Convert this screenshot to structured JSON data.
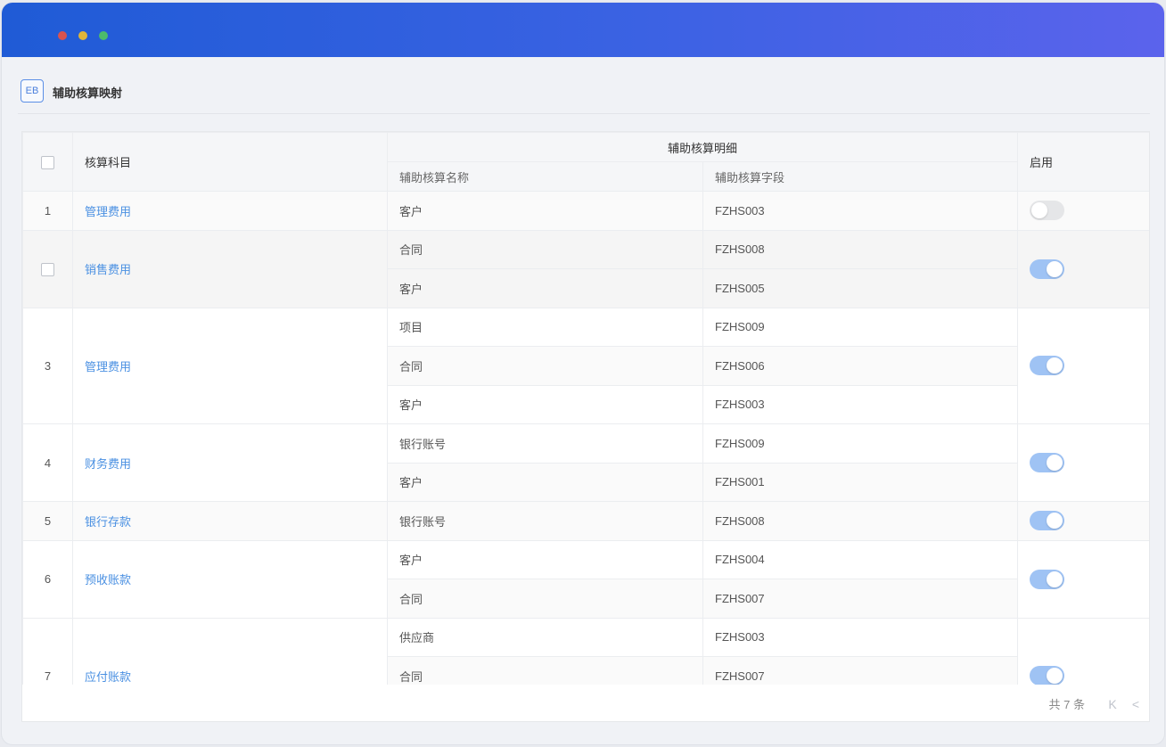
{
  "header": {
    "icon_text": "EB",
    "title": "辅助核算映射"
  },
  "table": {
    "columns": {
      "subject": "核算科目",
      "detail_group": "辅助核算明细",
      "detail_name": "辅助核算名称",
      "detail_field": "辅助核算字段",
      "enabled": "启用"
    },
    "rows": [
      {
        "index": "1",
        "subject": "管理费用",
        "enabled": false,
        "details": [
          {
            "name": "客户",
            "field": "FZHS003"
          }
        ]
      },
      {
        "index": "",
        "subject": "销售费用",
        "enabled": true,
        "details": [
          {
            "name": "合同",
            "field": "FZHS008"
          },
          {
            "name": "客户",
            "field": "FZHS005"
          }
        ]
      },
      {
        "index": "3",
        "subject": "管理费用",
        "enabled": true,
        "details": [
          {
            "name": "项目",
            "field": "FZHS009"
          },
          {
            "name": "合同",
            "field": "FZHS006"
          },
          {
            "name": "客户",
            "field": "FZHS003"
          }
        ]
      },
      {
        "index": "4",
        "subject": "财务费用",
        "enabled": true,
        "details": [
          {
            "name": "银行账号",
            "field": "FZHS009"
          },
          {
            "name": "客户",
            "field": "FZHS001"
          }
        ]
      },
      {
        "index": "5",
        "subject": "银行存款",
        "enabled": true,
        "details": [
          {
            "name": "银行账号",
            "field": "FZHS008"
          }
        ]
      },
      {
        "index": "6",
        "subject": "预收账款",
        "enabled": true,
        "details": [
          {
            "name": "客户",
            "field": "FZHS004"
          },
          {
            "name": "合同",
            "field": "FZHS007"
          }
        ]
      },
      {
        "index": "7",
        "subject": "应付账款",
        "enabled": true,
        "details": [
          {
            "name": "供应商",
            "field": "FZHS003"
          },
          {
            "name": "合同",
            "field": "FZHS007"
          },
          {
            "name": "",
            "field": ""
          }
        ]
      }
    ]
  },
  "pagination": {
    "total_text": "共 7 条",
    "first_glyph": "K",
    "prev_glyph": "<"
  },
  "colors": {
    "titlebar_start": "#1f5bd6",
    "titlebar_end": "#5b63ec",
    "link": "#4a90e2",
    "toggle_on": "#9fc3f4",
    "toggle_off": "#e5e6e8"
  }
}
